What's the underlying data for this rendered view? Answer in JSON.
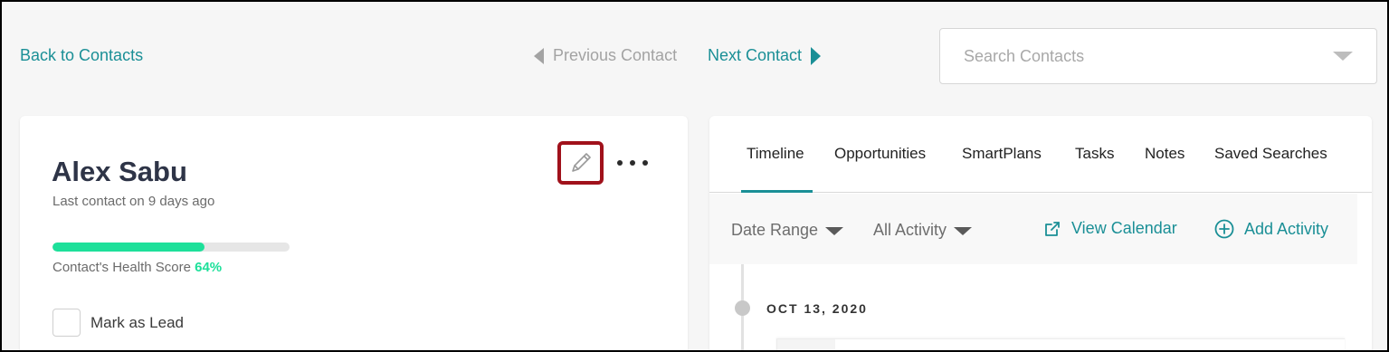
{
  "top_nav": {
    "back_label": "Back to Contacts",
    "prev_label": "Previous Contact",
    "next_label": "Next Contact",
    "search_placeholder": "Search Contacts"
  },
  "contact": {
    "name": "Alex Sabu",
    "last_contact": "Last contact on 9 days ago",
    "health_label": "Contact's Health Score",
    "health_value": "64%",
    "health_fraction": 0.64,
    "mark_as_lead_label": "Mark as Lead",
    "mark_as_lead_checked": false
  },
  "tabs": [
    {
      "label": "Timeline",
      "active": true
    },
    {
      "label": "Opportunities",
      "active": false
    },
    {
      "label": "SmartPlans",
      "active": false
    },
    {
      "label": "Tasks",
      "active": false
    },
    {
      "label": "Notes",
      "active": false
    },
    {
      "label": "Saved Searches",
      "active": false
    }
  ],
  "filters": {
    "date_range_label": "Date Range",
    "activity_label": "All Activity",
    "view_calendar_label": "View Calendar",
    "add_activity_label": "Add Activity"
  },
  "timeline": {
    "date": "OCT 13, 2020"
  },
  "colors": {
    "accent": "#1a8f96",
    "health": "#1de09a",
    "highlight": "#a0111b"
  },
  "icons": {
    "prev": "triangle-left-icon",
    "next": "triangle-right-icon",
    "search_dropdown": "caret-down-icon",
    "edit": "pencil-icon",
    "more": "more-dots-icon",
    "view_calendar": "external-link-icon",
    "add_activity": "plus-circle-icon"
  }
}
